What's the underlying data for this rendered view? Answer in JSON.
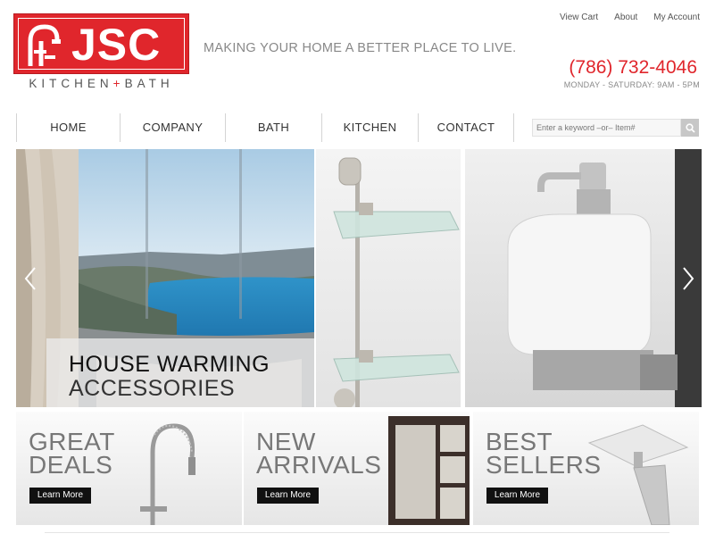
{
  "logo": {
    "letters": "JSC",
    "sub_left": "KITCHEN",
    "sub_plus": "+",
    "sub_right": "BATH"
  },
  "tagline": "MAKING YOUR HOME A BETTER PLACE TO LIVE.",
  "top_links": [
    "View Cart",
    "About",
    "My Account"
  ],
  "phone": "(786) 732-4046",
  "hours": "MONDAY - SATURDAY: 9AM - 5PM",
  "nav": [
    "HOME",
    "COMPANY",
    "BATH",
    "KITCHEN",
    "CONTACT"
  ],
  "search": {
    "placeholder": "Enter a keyword –or– Item#",
    "icon": "search-icon"
  },
  "hero": {
    "line1": "HOUSE WARMING",
    "line2": "ACCESSORIES"
  },
  "promos": [
    {
      "line1": "GREAT",
      "line2": "DEALS",
      "button": "Learn More"
    },
    {
      "line1": "NEW",
      "line2": "ARRIVALS",
      "button": "Learn More"
    },
    {
      "line1": "BEST",
      "line2": "SELLERS",
      "button": "Learn More"
    }
  ],
  "colors": {
    "brand_red": "#e0262c",
    "text_gray": "#888888",
    "button_black": "#111111"
  }
}
